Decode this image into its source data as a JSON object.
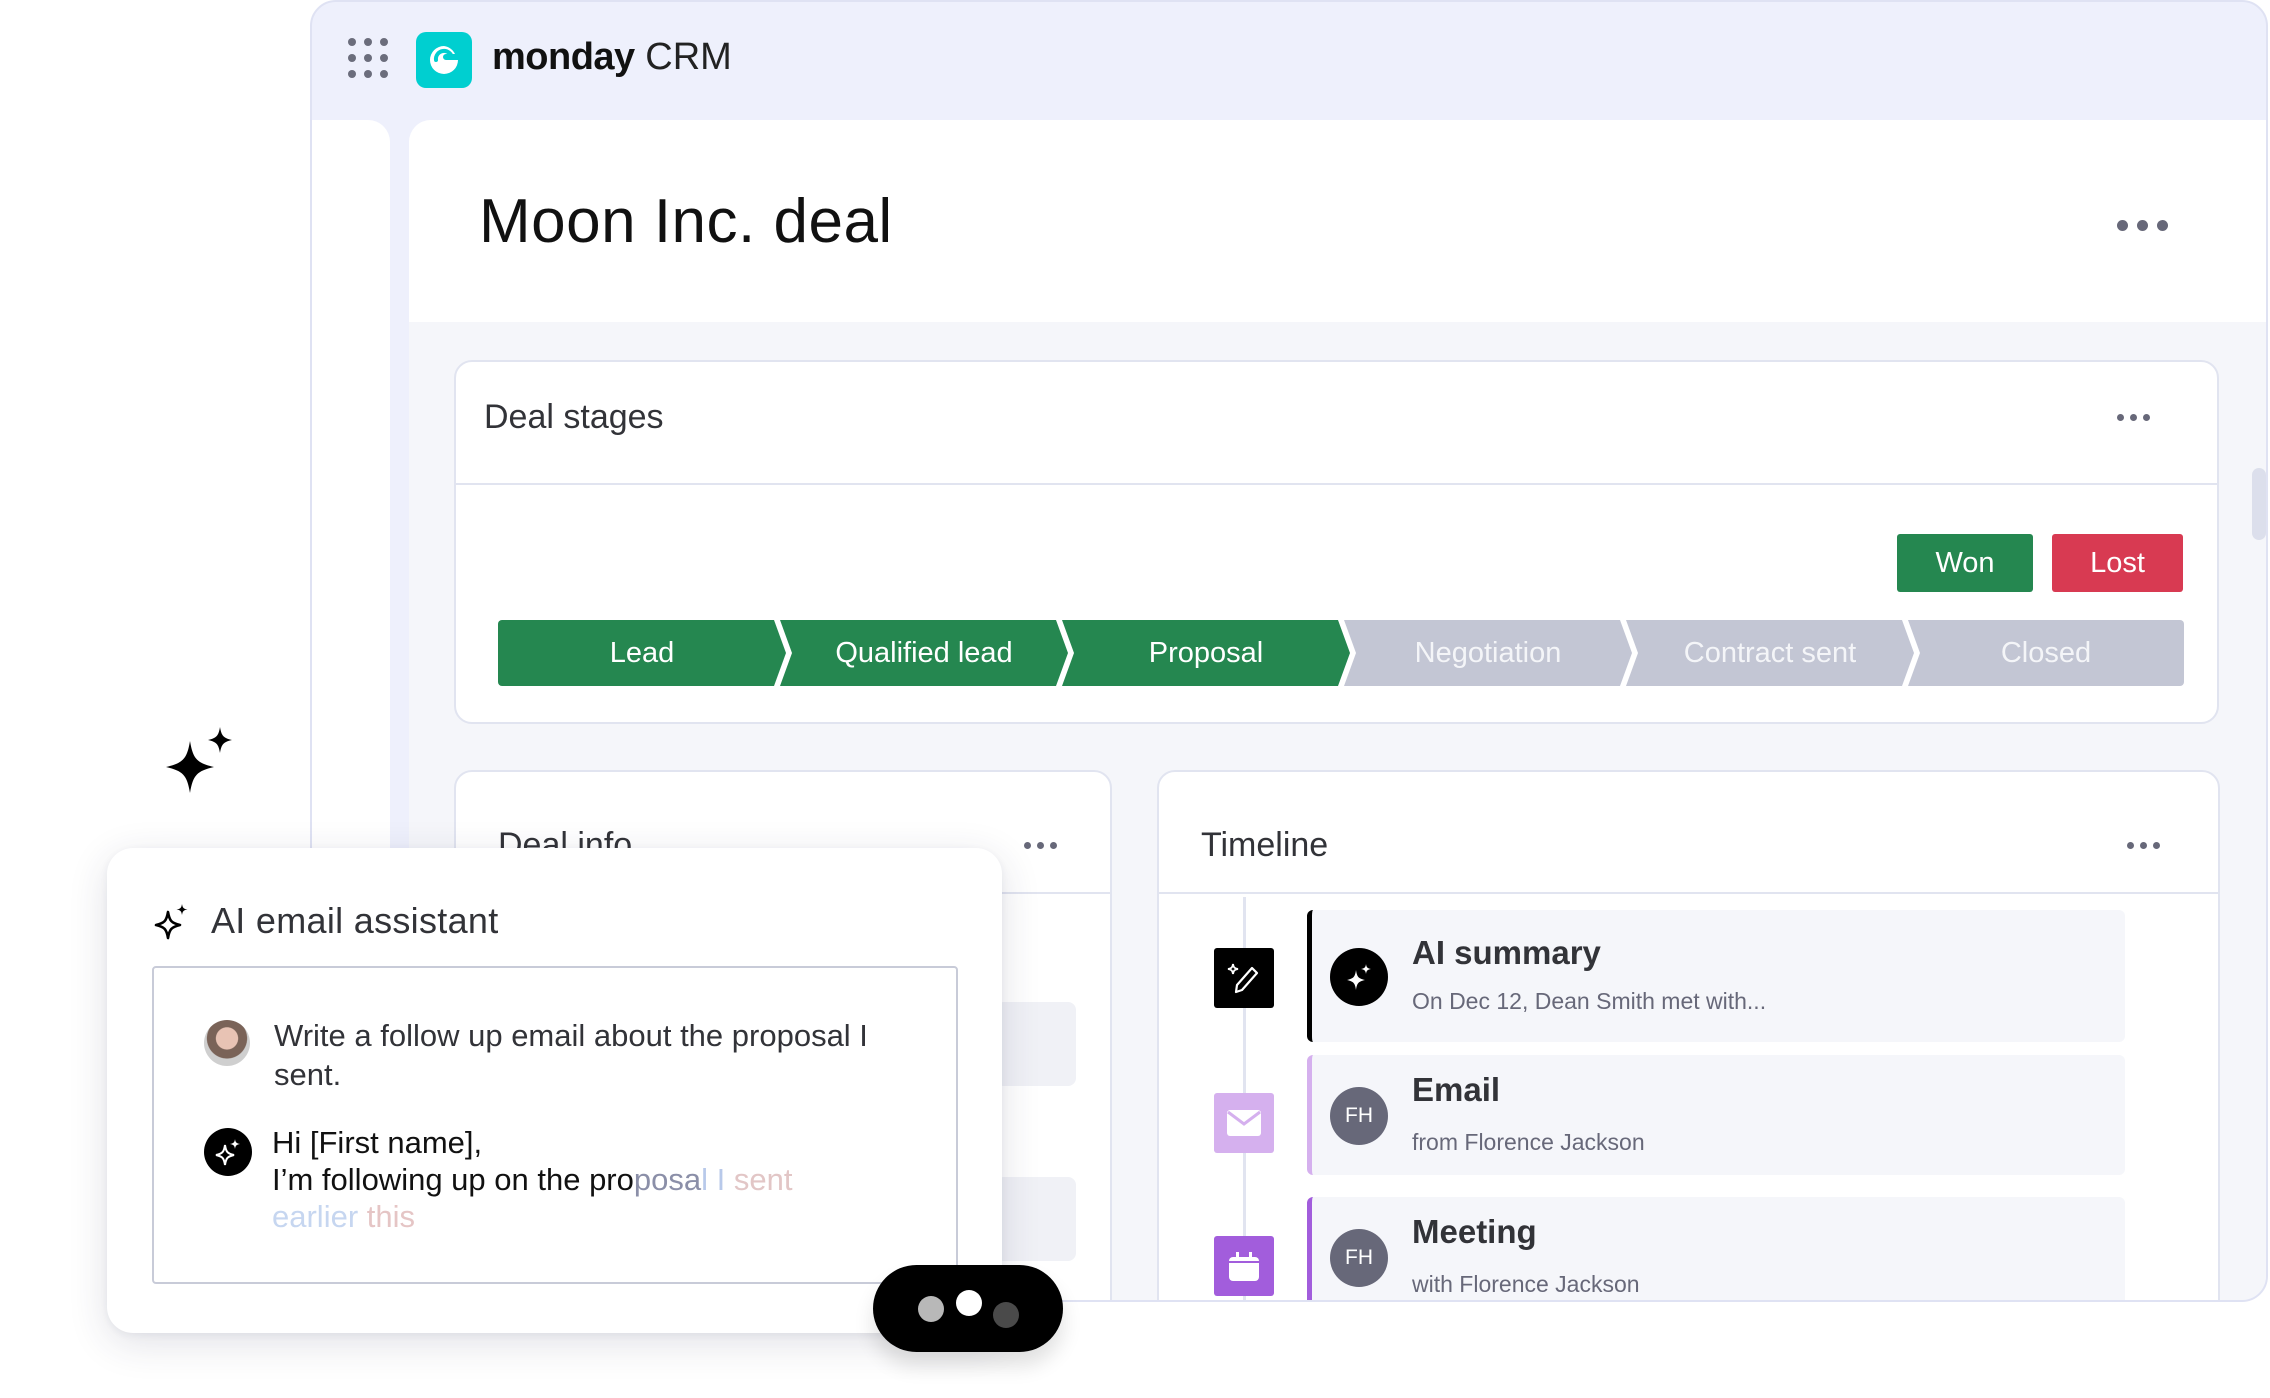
{
  "app": {
    "brand_bold": "monday",
    "brand_light": "CRM"
  },
  "page": {
    "title": "Moon Inc. deal"
  },
  "deal_stages": {
    "title": "Deal stages",
    "won_label": "Won",
    "lost_label": "Lost",
    "stages": [
      {
        "label": "Lead",
        "status": "done"
      },
      {
        "label": "Qualified lead",
        "status": "done"
      },
      {
        "label": "Proposal",
        "status": "done"
      },
      {
        "label": "Negotiation",
        "status": "todo"
      },
      {
        "label": "Contract sent",
        "status": "todo"
      },
      {
        "label": "Closed",
        "status": "todo"
      }
    ],
    "colors": {
      "done": "#258750",
      "todo": "#c3c6d4",
      "won": "#258750",
      "lost": "#d83a52"
    }
  },
  "deal_info": {
    "title": "Deal info"
  },
  "timeline": {
    "title": "Timeline",
    "items": [
      {
        "icon": "ai-pen-icon",
        "avatar": "sparkle",
        "title": "AI summary",
        "subtitle": "On Dec 12, Dean Smith met with...",
        "accent": "#000000"
      },
      {
        "icon": "envelope-icon",
        "avatar": "FH",
        "title": "Email",
        "subtitle": "from Florence Jackson",
        "accent": "#d5b0ee"
      },
      {
        "icon": "calendar-icon",
        "avatar": "FH",
        "title": "Meeting",
        "subtitle": "with Florence Jackson",
        "accent": "#a25ddc"
      }
    ]
  },
  "ai_assistant": {
    "title": "AI email assistant",
    "user_prompt": "Write a follow up email about the proposal I sent.",
    "reply_line1": "Hi [First name],",
    "reply_line2_solid": "I’m following up on the pro",
    "reply_line2_fade_a": "posa",
    "reply_line2_fade_b": "l I ",
    "reply_line2_fade_c": "sent",
    "reply_line3_a": "earlier ",
    "reply_line3_b": "this"
  },
  "typing_indicator": {
    "state": "typing"
  }
}
